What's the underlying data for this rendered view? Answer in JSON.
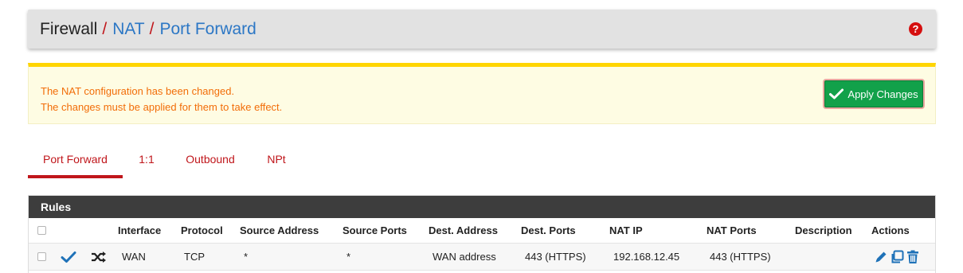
{
  "breadcrumb": {
    "firewall": "Firewall",
    "sep1": "/",
    "nat": "NAT",
    "sep2": "/",
    "port_forward": "Port Forward"
  },
  "help_icon": {
    "glyph": "?",
    "name": "question-circle-icon"
  },
  "alert": {
    "line1": "The NAT configuration has been changed.",
    "line2": "The changes must be applied for them to take effect.",
    "apply_label": "Apply Changes"
  },
  "tabs": [
    {
      "label": "Port Forward",
      "active": true
    },
    {
      "label": "1:1",
      "active": false
    },
    {
      "label": "Outbound",
      "active": false
    },
    {
      "label": "NPt",
      "active": false
    }
  ],
  "rules": {
    "title": "Rules",
    "columns": {
      "interface": "Interface",
      "protocol": "Protocol",
      "source_address": "Source Address",
      "source_ports": "Source Ports",
      "dest_address": "Dest. Address",
      "dest_ports": "Dest. Ports",
      "nat_ip": "NAT IP",
      "nat_ports": "NAT Ports",
      "description": "Description",
      "actions": "Actions"
    },
    "rows": [
      {
        "interface": "WAN",
        "protocol": "TCP",
        "source_address": "*",
        "source_ports": "*",
        "dest_address": "WAN address",
        "dest_ports": "443 (HTTPS)",
        "nat_ip": "192.168.12.45",
        "nat_ports": "443 (HTTPS)",
        "description": ""
      }
    ]
  },
  "colors": {
    "accent_red": "#c0161b",
    "link_blue": "#2c77c5",
    "alert_orange": "#f26d08",
    "apply_green": "#12a14a",
    "icon_blue": "#1f72b8"
  }
}
